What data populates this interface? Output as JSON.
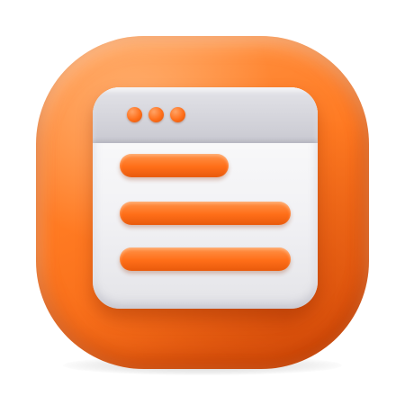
{
  "icon": {
    "name": "browser-window-icon",
    "colors": {
      "tile": "#ff7a22",
      "window": "#f1f1f4",
      "titlebar": "#c9c9d1",
      "accent": "#ff6e18"
    },
    "window_dots": 3,
    "content_lines": 3
  }
}
